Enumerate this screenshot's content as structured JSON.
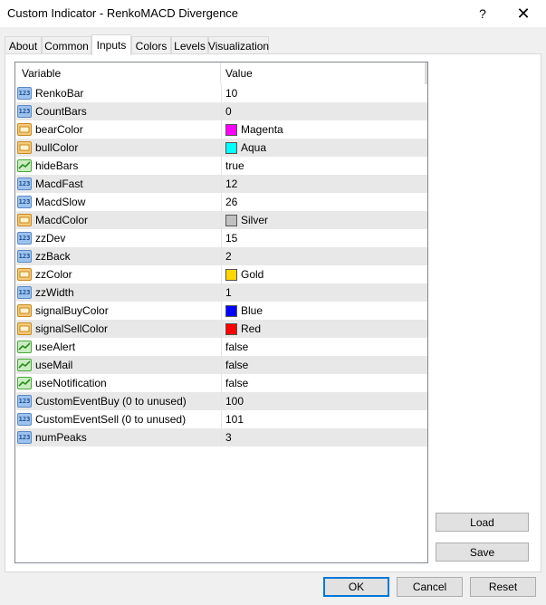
{
  "window": {
    "title": "Custom Indicator - RenkoMACD Divergence",
    "help_glyph": "?",
    "close_glyph": "✕"
  },
  "tabs": [
    {
      "label": "About"
    },
    {
      "label": "Common"
    },
    {
      "label": "Inputs"
    },
    {
      "label": "Colors"
    },
    {
      "label": "Levels"
    },
    {
      "label": "Visualization"
    }
  ],
  "active_tab": "Inputs",
  "grid": {
    "columns": [
      "Variable",
      "Value"
    ],
    "rows": [
      {
        "name": "RenkoBar",
        "value": "10",
        "type": "int"
      },
      {
        "name": "CountBars",
        "value": "0",
        "type": "int"
      },
      {
        "name": "bearColor",
        "value": "Magenta",
        "type": "color",
        "swatch": "#ff00ff"
      },
      {
        "name": "bullColor",
        "value": "Aqua",
        "type": "color",
        "swatch": "#00ffff"
      },
      {
        "name": "hideBars",
        "value": "true",
        "type": "bool"
      },
      {
        "name": "MacdFast",
        "value": "12",
        "type": "int"
      },
      {
        "name": "MacdSlow",
        "value": "26",
        "type": "int"
      },
      {
        "name": "MacdColor",
        "value": "Silver",
        "type": "color",
        "swatch": "#c0c0c0"
      },
      {
        "name": "zzDev",
        "value": "15",
        "type": "int"
      },
      {
        "name": "zzBack",
        "value": "2",
        "type": "int"
      },
      {
        "name": "zzColor",
        "value": "Gold",
        "type": "color",
        "swatch": "#ffd700"
      },
      {
        "name": "zzWidth",
        "value": "1",
        "type": "int"
      },
      {
        "name": "signalBuyColor",
        "value": "Blue",
        "type": "color",
        "swatch": "#0000ff"
      },
      {
        "name": "signalSellColor",
        "value": "Red",
        "type": "color",
        "swatch": "#ff0000"
      },
      {
        "name": "useAlert",
        "value": "false",
        "type": "bool"
      },
      {
        "name": "useMail",
        "value": "false",
        "type": "bool"
      },
      {
        "name": "useNotification",
        "value": "false",
        "type": "bool"
      },
      {
        "name": "CustomEventBuy (0 to unused)",
        "value": "100",
        "type": "int"
      },
      {
        "name": "CustomEventSell (0 to unused)",
        "value": "101",
        "type": "int"
      },
      {
        "name": "numPeaks",
        "value": "3",
        "type": "int"
      }
    ]
  },
  "buttons": {
    "load": "Load",
    "save": "Save",
    "ok": "OK",
    "cancel": "Cancel",
    "reset": "Reset"
  },
  "colors": {
    "accent": "#0078d7",
    "row_alt": "#e8e8e8"
  }
}
